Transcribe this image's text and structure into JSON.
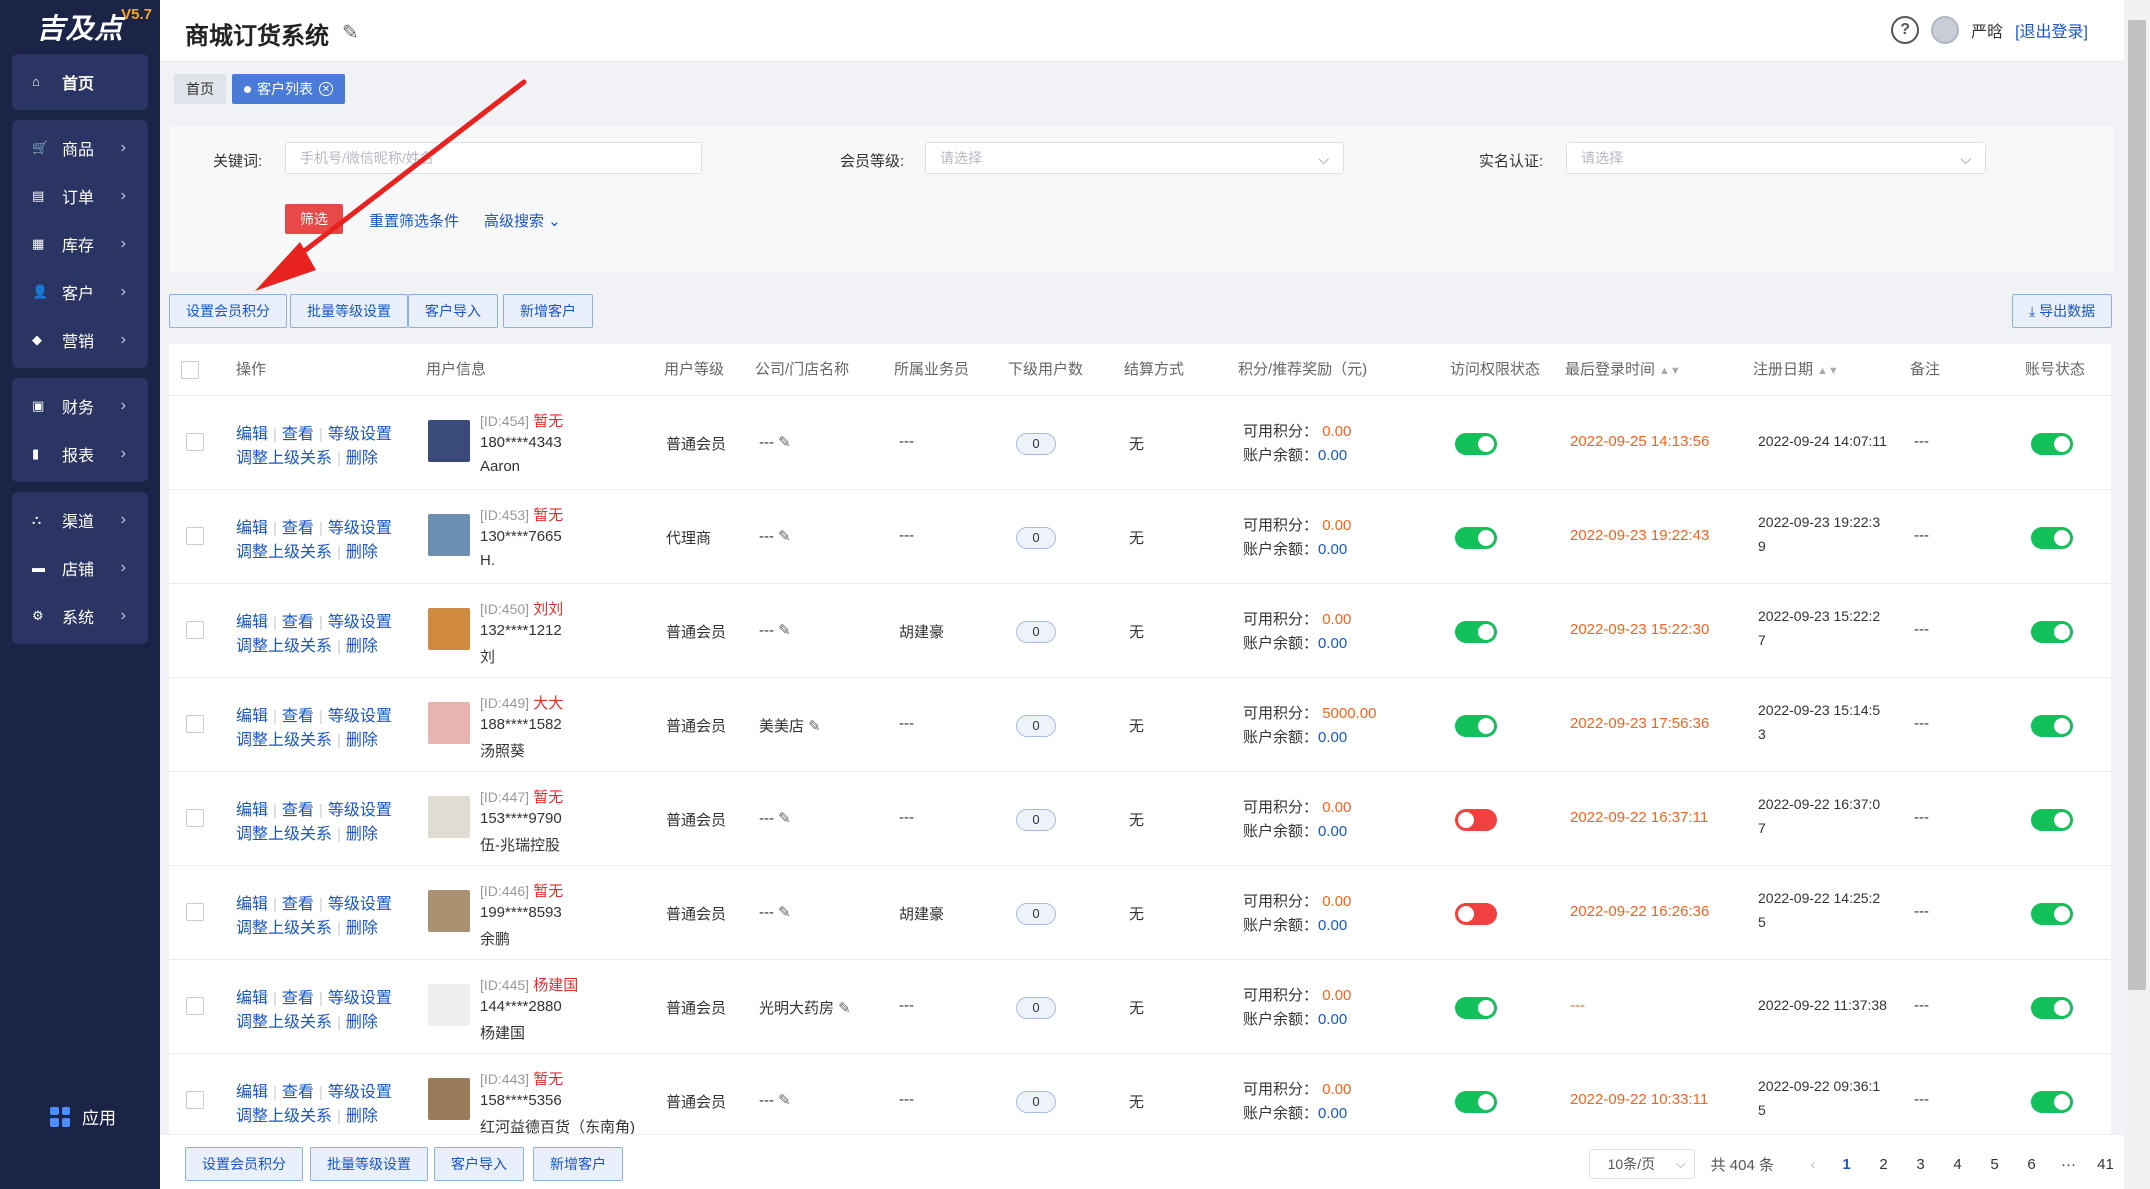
{
  "sidebar": {
    "brand": "吉及点",
    "version": "V5.7",
    "groups": [
      [
        {
          "label": "首页",
          "icon": "home-icon"
        }
      ],
      [
        {
          "label": "商品",
          "icon": "cart-icon"
        },
        {
          "label": "订单",
          "icon": "order-icon"
        },
        {
          "label": "库存",
          "icon": "inventory-icon"
        },
        {
          "label": "客户",
          "icon": "user-icon"
        },
        {
          "label": "营销",
          "icon": "tag-icon"
        }
      ],
      [
        {
          "label": "财务",
          "icon": "finance-icon"
        },
        {
          "label": "报表",
          "icon": "chart-icon"
        }
      ],
      [
        {
          "label": "渠道",
          "icon": "channel-icon"
        },
        {
          "label": "店铺",
          "icon": "store-icon"
        },
        {
          "label": "系统",
          "icon": "gear-icon"
        }
      ]
    ],
    "apps_label": "应用"
  },
  "header": {
    "title": "商城订货系统",
    "user_name": "严晗",
    "logout": "[退出登录]",
    "help": "?"
  },
  "tabs": {
    "home": "首页",
    "active": "客户列表",
    "close": "✕"
  },
  "filter": {
    "keyword_label": "关键词:",
    "keyword_placeholder": "手机号/微信昵称/姓名",
    "level_label": "会员等级:",
    "level_placeholder": "请选择",
    "realname_label": "实名认证:",
    "realname_placeholder": "请选择",
    "filter_btn": "筛选",
    "reset": "重置筛选条件",
    "advanced": "高级搜索 ⌄"
  },
  "toolbar": {
    "set_points": "设置会员积分",
    "batch_level": "批量等级设置",
    "import": "客户导入",
    "add": "新增客户",
    "export": "⤓ 导出数据"
  },
  "table": {
    "headers": {
      "ops": "操作",
      "user": "用户信息",
      "level": "用户等级",
      "company": "公司/门店名称",
      "sales": "所属业务员",
      "sub": "下级用户数",
      "settle": "结算方式",
      "points": "积分/推荐奖励（元)",
      "access": "访问权限状态",
      "last_login": "最后登录时间",
      "reg": "注册日期",
      "remark": "备注",
      "status": "账号状态"
    },
    "ops": {
      "edit": "编辑",
      "view": "查看",
      "level": "等级设置",
      "parent": "调整上级关系",
      "delete": "删除"
    },
    "points_label": "可用积分：",
    "balance_label": "账户余额：",
    "rows": [
      {
        "id": "[ID:454]",
        "nick": "暂无",
        "phone": "180****4343",
        "name": "Aaron",
        "level": "普通会员",
        "company": "---",
        "sales": "---",
        "sub": "0",
        "settle": "无",
        "points": "0.00",
        "balance": "0.00",
        "access": true,
        "last_login": "2022-09-25 14:13:56",
        "reg1": "2022-09-24 14:07:11",
        "reg2": "",
        "remark": "---",
        "status": true,
        "thumb": "#3a4a7a"
      },
      {
        "id": "[ID:453]",
        "nick": "暂无",
        "phone": "130****7665",
        "name": "H.",
        "level": "代理商",
        "company": "---",
        "sales": "---",
        "sub": "0",
        "settle": "无",
        "points": "0.00",
        "balance": "0.00",
        "access": true,
        "last_login": "2022-09-23 19:22:43",
        "reg1": "2022-09-23 19:22:3",
        "reg2": "9",
        "remark": "---",
        "status": true,
        "thumb": "#6a8fb0"
      },
      {
        "id": "[ID:450]",
        "nick": "刘刘",
        "phone": "132****1212",
        "name": "刘",
        "level": "普通会员",
        "company": "---",
        "sales": "胡建豪",
        "sub": "0",
        "settle": "无",
        "points": "0.00",
        "balance": "0.00",
        "access": true,
        "last_login": "2022-09-23 15:22:30",
        "reg1": "2022-09-23 15:22:2",
        "reg2": "7",
        "remark": "---",
        "status": true,
        "thumb": "#d08a40"
      },
      {
        "id": "[ID:449]",
        "nick": "大大",
        "phone": "188****1582",
        "name": "汤照葵",
        "level": "普通会员",
        "company": "美美店",
        "sales": "---",
        "sub": "0",
        "settle": "无",
        "points": "5000.00",
        "balance": "0.00",
        "access": true,
        "last_login": "2022-09-23 17:56:36",
        "reg1": "2022-09-23 15:14:5",
        "reg2": "3",
        "remark": "---",
        "status": true,
        "thumb": "#e8b4b0"
      },
      {
        "id": "[ID:447]",
        "nick": "暂无",
        "phone": "153****9790",
        "name": "伍-兆瑞控股",
        "level": "普通会员",
        "company": "---",
        "sales": "---",
        "sub": "0",
        "settle": "无",
        "points": "0.00",
        "balance": "0.00",
        "access": false,
        "last_login": "2022-09-22 16:37:11",
        "reg1": "2022-09-22 16:37:0",
        "reg2": "7",
        "remark": "---",
        "status": true,
        "thumb": "#e0dcd4"
      },
      {
        "id": "[ID:446]",
        "nick": "暂无",
        "phone": "199****8593",
        "name": "余鹏",
        "level": "普通会员",
        "company": "---",
        "sales": "胡建豪",
        "sub": "0",
        "settle": "无",
        "points": "0.00",
        "balance": "0.00",
        "access": false,
        "last_login": "2022-09-22 16:26:36",
        "reg1": "2022-09-22 14:25:2",
        "reg2": "5",
        "remark": "---",
        "status": true,
        "thumb": "#a89070"
      },
      {
        "id": "[ID:445]",
        "nick": "杨建国",
        "phone": "144****2880",
        "name": "杨建国",
        "level": "普通会员",
        "company": "光明大药房",
        "sales": "---",
        "sub": "0",
        "settle": "无",
        "points": "0.00",
        "balance": "0.00",
        "access": true,
        "last_login": "---",
        "reg1": "2022-09-22 11:37:38",
        "reg2": "",
        "remark": "---",
        "status": true,
        "thumb": "#eeeeee"
      },
      {
        "id": "[ID:443]",
        "nick": "暂无",
        "phone": "158****5356",
        "name": "红河益德百货（东南角)",
        "level": "普通会员",
        "company": "---",
        "sales": "---",
        "sub": "0",
        "settle": "无",
        "points": "0.00",
        "balance": "0.00",
        "access": true,
        "last_login": "2022-09-22 10:33:11",
        "reg1": "2022-09-22 09:36:1",
        "reg2": "5",
        "remark": "---",
        "status": true,
        "thumb": "#9a7a58"
      }
    ]
  },
  "pager": {
    "page_size": "10条/页",
    "total": "共 404 条",
    "prev": "‹",
    "pages": [
      "1",
      "2",
      "3",
      "4",
      "5",
      "6",
      "···",
      "41"
    ],
    "current": "1"
  }
}
